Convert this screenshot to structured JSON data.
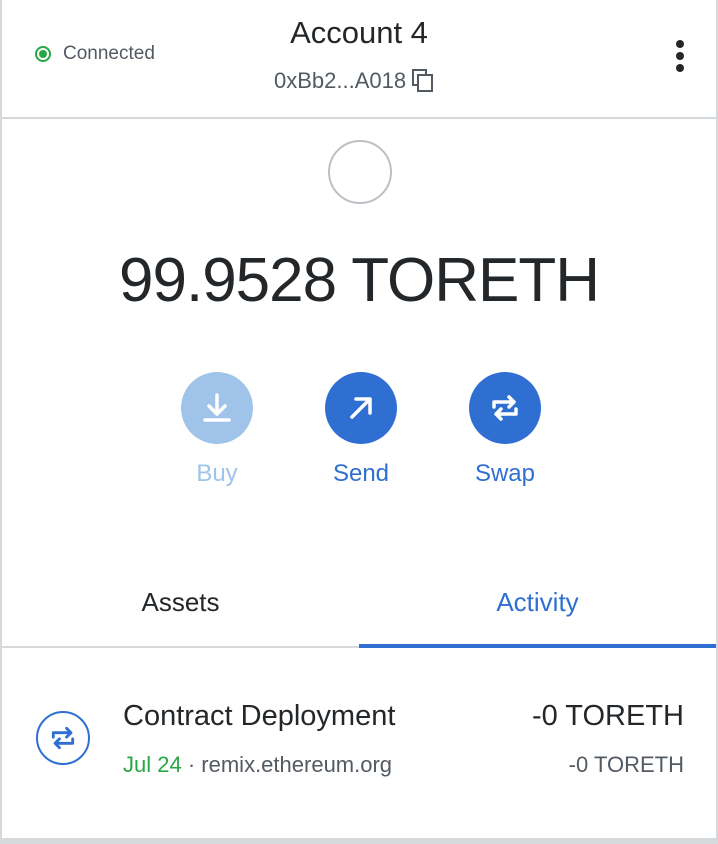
{
  "header": {
    "connection_status": "Connected",
    "account_name": "Account 4",
    "account_address": "0xBb2...A018"
  },
  "balance": {
    "amount": "99.9528 TORETH"
  },
  "actions": [
    {
      "label": "Buy",
      "enabled": false
    },
    {
      "label": "Send",
      "enabled": true
    },
    {
      "label": "Swap",
      "enabled": true
    }
  ],
  "tabs": [
    {
      "label": "Assets",
      "active": false
    },
    {
      "label": "Activity",
      "active": true
    }
  ],
  "activity": [
    {
      "title": "Contract Deployment",
      "date": "Jul 24",
      "separator": "·",
      "origin": "remix.ethereum.org",
      "amount": "-0 TORETH",
      "fiat_amount": "-0 TORETH"
    }
  ],
  "colors": {
    "accent": "#2f6fd1",
    "connected": "#28a745",
    "disabled": "#9fc3e9"
  }
}
